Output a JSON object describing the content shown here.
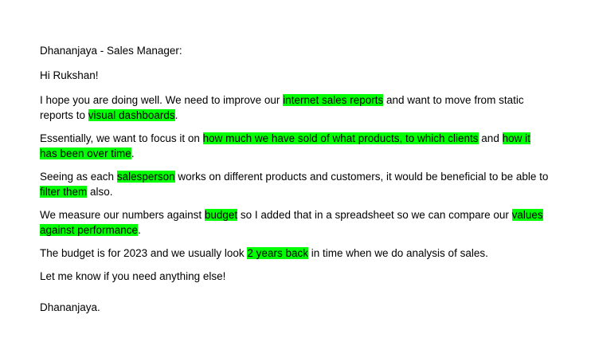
{
  "document": {
    "header": "Dhananjaya - Sales Manager:",
    "greeting": "Hi Rukshan!",
    "p1": {
      "t1": "I hope you are doing well. We need to improve our ",
      "h1": "internet sales reports",
      "t2": " and want to move from static reports to ",
      "h2": "visual dashboards",
      "t3": "."
    },
    "p2": {
      "t1": "Essentially, we want to focus it on ",
      "h1": "how much we have sold of what products, to which clients",
      "t2": " and ",
      "h2": "how it has been over time",
      "t3": "."
    },
    "p3": {
      "t1": "Seeing as each ",
      "h1": "salesperson",
      "t2": " works on different products and customers, it would be beneficial to be able to ",
      "h2": "filter them",
      "t3": " also."
    },
    "p4": {
      "t1": "We measure our numbers against ",
      "h1": "budget",
      "t2": " so I added that in a spreadsheet so we can compare our ",
      "h2": "values against performance",
      "t3": "."
    },
    "p5": {
      "t1": "The budget is for 2023 and we usually look ",
      "h1": "2 years back",
      "t2": " in time when we do analysis of sales."
    },
    "closing": "Let me know if you need anything else!",
    "signature": "Dhananjaya.",
    "highlight_color": "#00ff00"
  }
}
